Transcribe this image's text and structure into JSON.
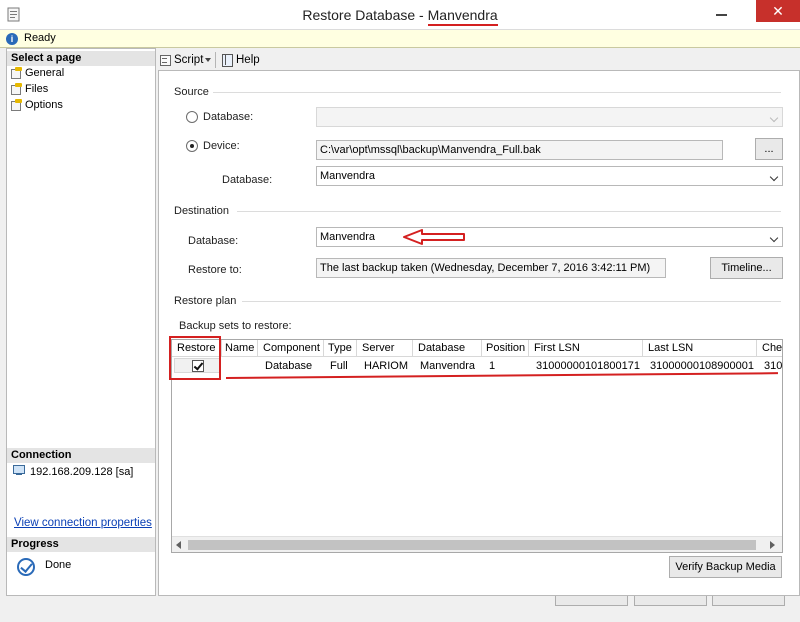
{
  "window": {
    "title_prefix": "Restore Database - ",
    "title_db": "Manvendra",
    "close_glyph": "✕"
  },
  "status": {
    "icon_glyph": "i",
    "text": "Ready"
  },
  "left": {
    "select_page_header": "Select a page",
    "pages": [
      "General",
      "Files",
      "Options"
    ],
    "connection_header": "Connection",
    "connection": "192.168.209.128 [sa]",
    "view_connection_link": "View connection properties",
    "progress_header": "Progress",
    "progress_status": "Done"
  },
  "toolbar": {
    "script_label": "Script",
    "help_label": "Help"
  },
  "source": {
    "section_label": "Source",
    "database_radio_label": "Database:",
    "device_radio_label": "Device:",
    "device_path": "C:\\var\\opt\\mssql\\backup\\Manvendra_Full.bak",
    "browse_label": "...",
    "database_label": "Database:",
    "database_value": "Manvendra"
  },
  "destination": {
    "section_label": "Destination",
    "database_label": "Database:",
    "database_value": "Manvendra",
    "restore_to_label": "Restore to:",
    "restore_to_value": "The last backup taken (Wednesday, December 7, 2016 3:42:11 PM)",
    "timeline_label": "Timeline..."
  },
  "restore_plan": {
    "section_label": "Restore plan",
    "backup_sets_label": "Backup sets to restore:",
    "columns": [
      "Restore",
      "Name",
      "Component",
      "Type",
      "Server",
      "Database",
      "Position",
      "First LSN",
      "Last LSN",
      "Chec"
    ],
    "rows": [
      {
        "restore": true,
        "name": "",
        "component": "Database",
        "type": "Full",
        "server": "HARIOM",
        "database": "Manvendra",
        "position": "1",
        "first_lsn": "31000000101800171",
        "last_lsn": "31000000108900001",
        "check": "310"
      }
    ],
    "verify_label": "Verify Backup Media"
  },
  "colors": {
    "annotation_red": "#d42020",
    "link_blue": "#0a3fb5",
    "status_yellow": "#ffffe1"
  }
}
